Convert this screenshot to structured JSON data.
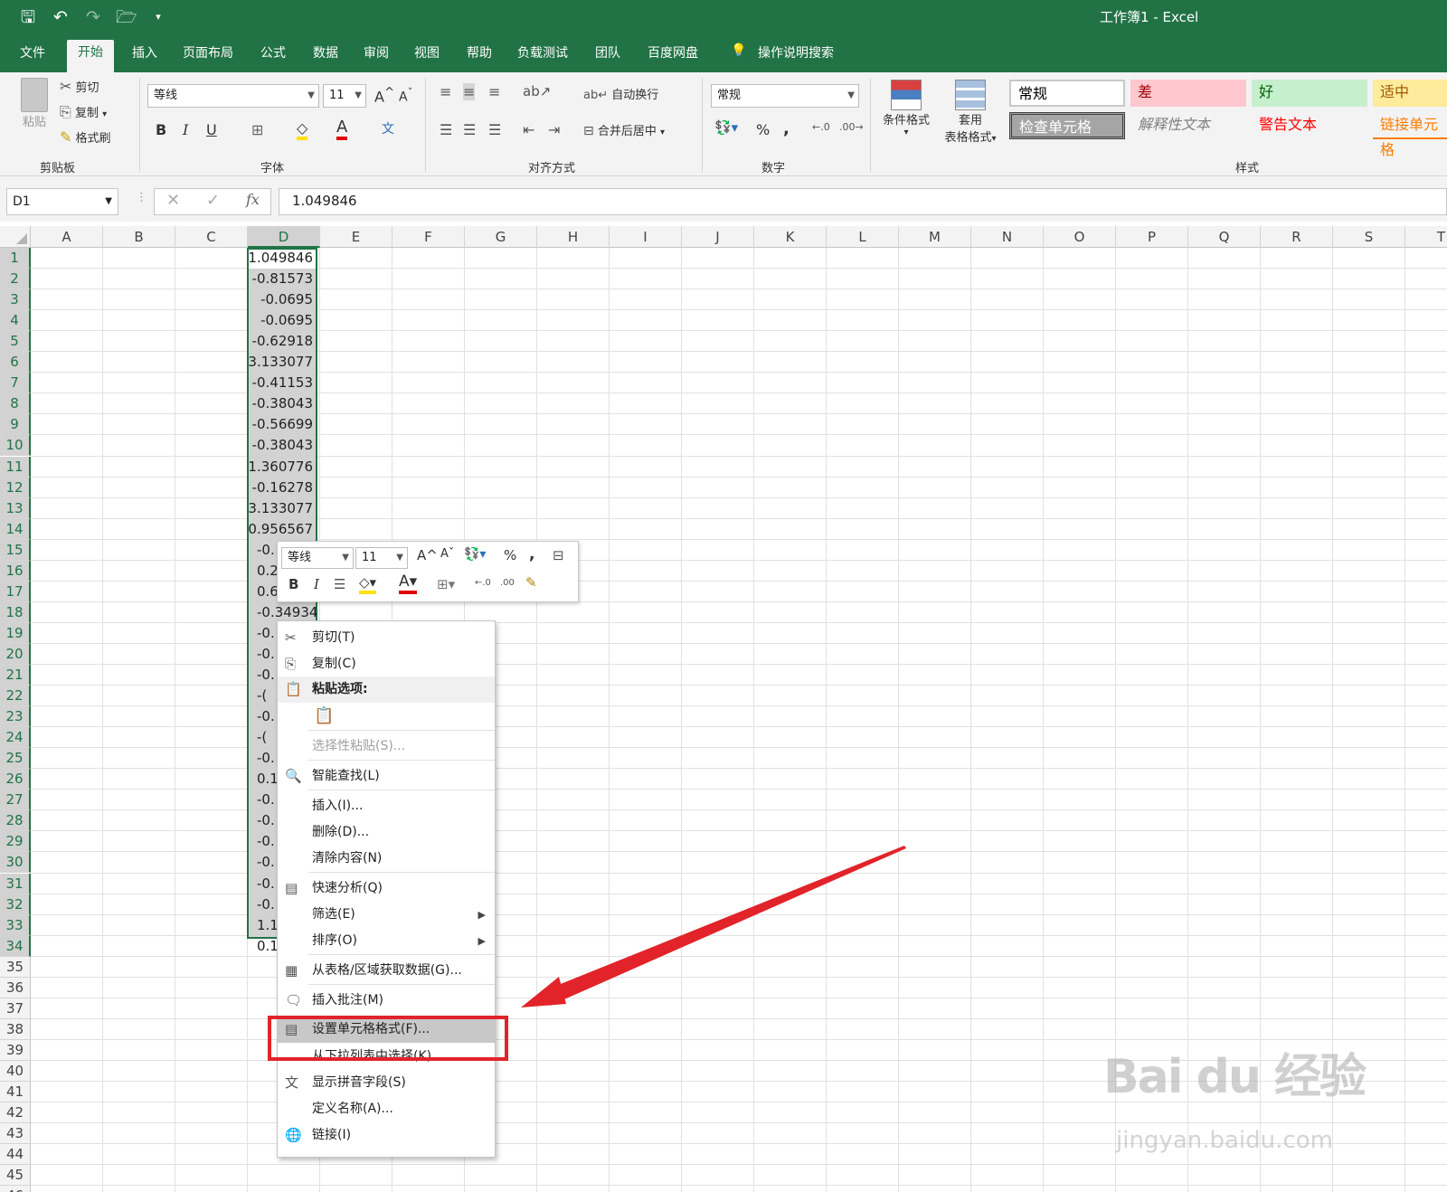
{
  "window": {
    "title": "工作簿1  -  Excel"
  },
  "tabs": [
    "文件",
    "开始",
    "插入",
    "页面布局",
    "公式",
    "数据",
    "审阅",
    "视图",
    "帮助",
    "负载测试",
    "团队",
    "百度网盘",
    "操作说明搜索"
  ],
  "ribbon": {
    "clipboard": {
      "paste": "粘贴",
      "cut": "剪切",
      "copy": "复制",
      "format_painter": "格式刷",
      "label": "剪贴板"
    },
    "font": {
      "name": "等线",
      "size": "11",
      "label": "字体",
      "bold": "B",
      "italic": "I",
      "underline": "U"
    },
    "alignment": {
      "wrap": "自动换行",
      "merge": "合并后居中",
      "label": "对齐方式"
    },
    "number": {
      "format": "常规",
      "percent": "%",
      "comma": ",",
      "label": "数字"
    },
    "styles": {
      "conditional": "条件格式",
      "table_1": "套用",
      "table_2": "表格格式",
      "label": "样式",
      "cells": [
        {
          "text": "常规",
          "bg": "#ffffff",
          "fg": "#000000"
        },
        {
          "text": "差",
          "bg": "#ffc7ce",
          "fg": "#9c0006"
        },
        {
          "text": "好",
          "bg": "#c6efce",
          "fg": "#006100"
        },
        {
          "text": "适中",
          "bg": "#ffeb9c",
          "fg": "#9c5700"
        },
        {
          "text": "检查单元格",
          "bg": "#a5a5a5",
          "fg": "#ffffff"
        },
        {
          "text": "解释性文本",
          "bg": "#f3f3f3",
          "fg": "#7f7f7f"
        },
        {
          "text": "警告文本",
          "bg": "#f3f3f3",
          "fg": "#ff0000"
        },
        {
          "text": "链接单元格",
          "bg": "#f3f3f3",
          "fg": "#fa7d00"
        }
      ]
    }
  },
  "formula_bar": {
    "name_box": "D1",
    "value": "1.049846",
    "fx": "fx"
  },
  "columns": [
    "A",
    "B",
    "C",
    "D",
    "E",
    "F",
    "G",
    "H",
    "I",
    "J",
    "K",
    "L",
    "M",
    "N",
    "O",
    "P",
    "Q",
    "R",
    "S",
    "T"
  ],
  "rows": [
    "1",
    "2",
    "3",
    "4",
    "5",
    "6",
    "7",
    "8",
    "9",
    "10",
    "11",
    "12",
    "13",
    "14",
    "15",
    "16",
    "17",
    "18",
    "19",
    "20",
    "21",
    "22",
    "23",
    "24",
    "25",
    "26",
    "27",
    "28",
    "29",
    "30",
    "31",
    "32",
    "33",
    "34",
    "35",
    "36",
    "37",
    "38",
    "39",
    "40",
    "41",
    "42",
    "43",
    "44",
    "45",
    "46"
  ],
  "column_d": [
    "1.049846",
    "-0.81573",
    "-0.0695",
    "-0.0695",
    "-0.62918",
    "3.133077",
    "-0.41153",
    "-0.38043",
    "-0.56699",
    "-0.38043",
    "1.360776",
    "-0.16278",
    "3.133077",
    "0.956567",
    "-0.",
    "0.2",
    "0.6",
    "-0.34934",
    "-0.",
    "-0.",
    "-0.",
    "-(",
    "-0.",
    "-(",
    "-0.",
    "0.1",
    "-0.",
    "-0.",
    "-0.",
    "-0.",
    "-0.",
    "-0.",
    "1.1",
    "0.1"
  ],
  "mini_toolbar": {
    "font": "等线",
    "size": "11",
    "percent": "%",
    "comma": ",",
    "bold": "B",
    "italic": "I"
  },
  "context_menu": [
    {
      "label": "剪切(T)",
      "icon": "scissors-icon"
    },
    {
      "label": "复制(C)",
      "icon": "copy-icon"
    },
    {
      "label": "粘贴选项:",
      "icon": "paste-icon",
      "header": true
    },
    {
      "label": "",
      "icon": "paste-option-icon"
    },
    {
      "label": "选择性粘贴(S)...",
      "disabled": true
    },
    {
      "label": "智能查找(L)",
      "icon": "search-icon"
    },
    {
      "label": "插入(I)..."
    },
    {
      "label": "删除(D)..."
    },
    {
      "label": "清除内容(N)"
    },
    {
      "label": "快速分析(Q)",
      "icon": "quick-analysis-icon"
    },
    {
      "label": "筛选(E)",
      "submenu": true
    },
    {
      "label": "排序(O)",
      "submenu": true
    },
    {
      "label": "从表格/区域获取数据(G)...",
      "icon": "table-icon"
    },
    {
      "label": "插入批注(M)",
      "icon": "comment-icon"
    },
    {
      "label": "设置单元格格式(F)...",
      "icon": "format-cells-icon",
      "highlighted": true
    },
    {
      "label": "从下拉列表中选择(K)..."
    },
    {
      "label": "显示拼音字段(S)",
      "icon": "phonetic-icon"
    },
    {
      "label": "定义名称(A)..."
    },
    {
      "label": "链接(I)",
      "icon": "link-icon"
    }
  ],
  "watermark": {
    "brand": "Bai du 经验",
    "url": "jingyan.baidu.com"
  },
  "colors": {
    "excel_green": "#217346",
    "annotation_red": "#e2232a"
  }
}
